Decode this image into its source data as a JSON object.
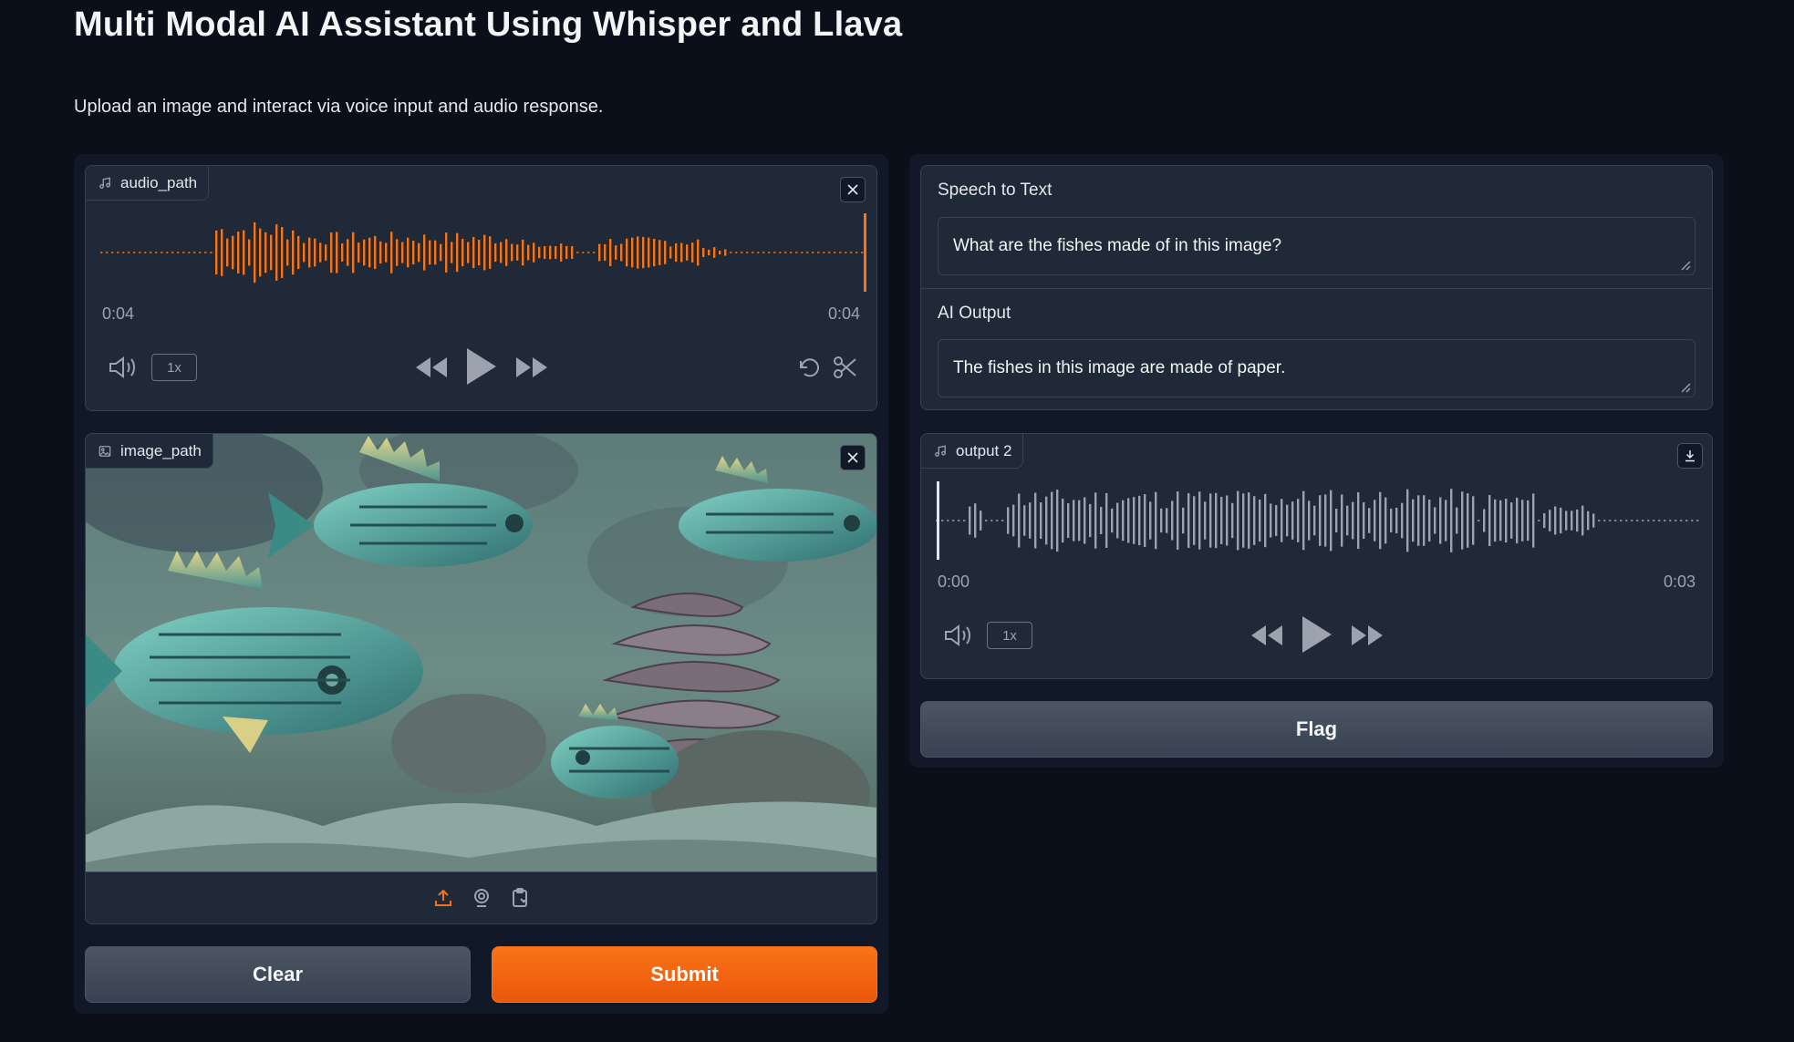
{
  "header": {
    "title": "Multi Modal AI Assistant Using Whisper and Llava",
    "subtitle": "Upload an image and interact via voice input and audio response."
  },
  "audio_input": {
    "label": "audio_path",
    "icon": "music-note-icon",
    "time_current": "0:04",
    "time_total": "0:04",
    "speed": "1x",
    "played_fraction": 1.0,
    "wave_color": "#f97316"
  },
  "image_input": {
    "label": "image_path",
    "icon": "image-icon",
    "sources": [
      "upload-icon",
      "webcam-icon",
      "clipboard-icon"
    ]
  },
  "speech_to_text": {
    "label": "Speech to Text",
    "value": "What are the fishes made of in this image?"
  },
  "ai_output": {
    "label": "AI Output",
    "value": "The fishes in this image are made of paper."
  },
  "audio_output": {
    "label": "output 2",
    "icon": "music-note-icon",
    "time_current": "0:00",
    "time_total": "0:03",
    "speed": "1x",
    "played_fraction": 0.0,
    "wave_color": "#9ca3af"
  },
  "buttons": {
    "clear": "Clear",
    "submit": "Submit",
    "flag": "Flag"
  },
  "colors": {
    "accent": "#f97316",
    "background": "#0b0f19",
    "panel": "#1f2937"
  }
}
